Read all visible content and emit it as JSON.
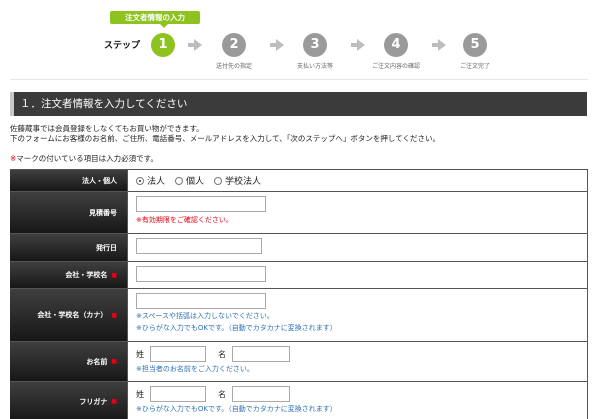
{
  "stepbar": {
    "badge": "注文者情報の入力",
    "label": "ステップ",
    "steps": [
      {
        "num": "1",
        "caption": ""
      },
      {
        "num": "2",
        "caption": "送付先の指定"
      },
      {
        "num": "3",
        "caption": "支払い方法等"
      },
      {
        "num": "4",
        "caption": "ご注文内容の確認"
      },
      {
        "num": "5",
        "caption": "ご注文完了"
      }
    ],
    "active_color": "#8dc21f",
    "inactive_color": "#9a9a9a"
  },
  "section": {
    "title": "１．注文者情報を入力してください",
    "intro_line1": "佐藤蔵事では会員登録をしなくてもお買い物ができます。",
    "intro_line2": "下のフォームにお客様のお名前、ご住所、電話番号、メールアドレスを入力して、「次のステップへ」ボタンを押してください。",
    "required_mark": "※",
    "required_text": "マークの付いている項目は入力必須です。"
  },
  "form": {
    "type_label": "法人・個人",
    "type_options": [
      "法人",
      "個人",
      "学校法人"
    ],
    "type_selected": "法人",
    "quote_label": "見積番号",
    "quote_note": "※有効期限をご確認ください。",
    "issue_label": "発行日",
    "company_label": "会社・学校名",
    "company_kana_label": "会社・学校名（カナ）",
    "company_kana_note1": "※スペースや括弧は入力しないでください。",
    "company_kana_note2": "※ひらがな入力でもOKです。（自動でカタカナに変換されます）",
    "name_label": "お名前",
    "name_sei": "姓",
    "name_mei": "名",
    "name_note": "※担当者のお名前をご入力ください。",
    "furigana_label": "フリガナ",
    "furigana_sei": "姓",
    "furigana_mei": "名",
    "furigana_note": "※ひらがな入力でもOKです。（自動でカタカナに変換されます）",
    "required_icon": "■"
  }
}
